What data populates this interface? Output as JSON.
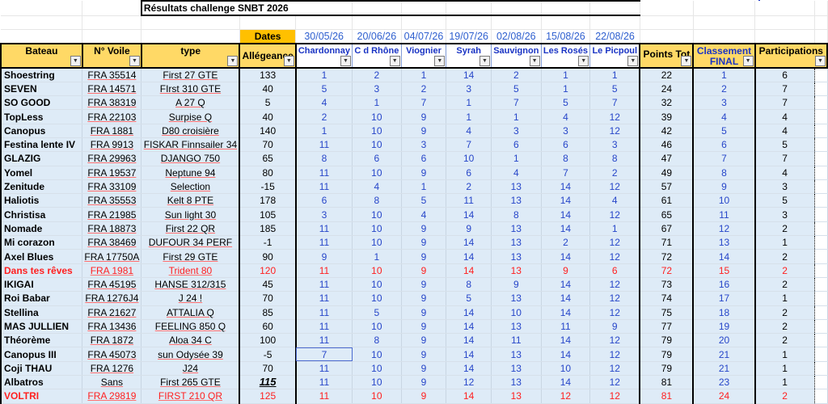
{
  "title": "Résultats challenge SNBT 2026",
  "dates_label": "Dates",
  "dates": [
    "30/05/26",
    "20/06/26",
    "04/07/26",
    "19/07/26",
    "02/08/26",
    "15/08/26",
    "22/08/26"
  ],
  "headers": {
    "bateau": "Bateau",
    "voile": "N° Voile",
    "type": "type",
    "allegeance": "Allégeance",
    "races": [
      "Chardonnay",
      "C d Rhône",
      "Viognier",
      "Syrah",
      "Sauvignon",
      "Les Rosés",
      "Le Picpoul"
    ],
    "points": "Points Tot",
    "classement_1": "Classement",
    "classement_2": "FINAL",
    "participations": "Participations"
  },
  "rows": [
    {
      "boat": "Shoestring",
      "sail": "FRA 35514",
      "type": "First 27 GTE",
      "alleg": "133",
      "r": [
        "1",
        "2",
        "1",
        "14",
        "2",
        "1",
        "1"
      ],
      "pts": "22",
      "rank": "1",
      "part": "6"
    },
    {
      "boat": "SEVEN",
      "sail": "FRA 14571",
      "type": "FIrst 310 GTE",
      "alleg": "40",
      "r": [
        "5",
        "3",
        "2",
        "3",
        "5",
        "1",
        "5"
      ],
      "pts": "24",
      "rank": "2",
      "part": "7"
    },
    {
      "boat": "SO GOOD",
      "sail": "FRA 38319",
      "type": "A 27 Q",
      "alleg": "5",
      "r": [
        "4",
        "1",
        "7",
        "1",
        "7",
        "5",
        "7"
      ],
      "pts": "32",
      "rank": "3",
      "part": "7"
    },
    {
      "boat": "TopLess",
      "sail": "FRA 22103",
      "type": "Surpise Q",
      "alleg": "40",
      "r": [
        "2",
        "10",
        "9",
        "1",
        "1",
        "4",
        "12"
      ],
      "pts": "39",
      "rank": "4",
      "part": "4"
    },
    {
      "boat": "Canopus",
      "sail": "FRA 1881",
      "type": "D80 croisière",
      "alleg": "140",
      "r": [
        "1",
        "10",
        "9",
        "4",
        "3",
        "3",
        "12"
      ],
      "pts": "42",
      "rank": "5",
      "part": "4"
    },
    {
      "boat": "Festina lente IV",
      "sail": "FRA 9913",
      "type": "FISKAR Finnsailer 34",
      "alleg": "70",
      "r": [
        "11",
        "10",
        "3",
        "7",
        "6",
        "6",
        "3"
      ],
      "pts": "46",
      "rank": "6",
      "part": "5"
    },
    {
      "boat": "GLAZIG",
      "sail": "FRA 29963",
      "type": "DJANGO 750",
      "alleg": "65",
      "r": [
        "8",
        "6",
        "6",
        "10",
        "1",
        "8",
        "8"
      ],
      "pts": "47",
      "rank": "7",
      "part": "7"
    },
    {
      "boat": "Yomel",
      "sail": "FRA 19537",
      "type": "Neptune 94",
      "alleg": "80",
      "r": [
        "11",
        "10",
        "9",
        "6",
        "4",
        "7",
        "2"
      ],
      "pts": "49",
      "rank": "8",
      "part": "4"
    },
    {
      "boat": "Zenitude",
      "sail": "FRA 33109",
      "type": "Selection",
      "alleg": "-15",
      "r": [
        "11",
        "4",
        "1",
        "2",
        "13",
        "14",
        "12"
      ],
      "pts": "57",
      "rank": "9",
      "part": "3"
    },
    {
      "boat": "Haliotis",
      "sail": "FRA 35553",
      "type": "Kelt 8 PTE",
      "alleg": "178",
      "r": [
        "6",
        "8",
        "5",
        "11",
        "13",
        "14",
        "4"
      ],
      "pts": "61",
      "rank": "10",
      "part": "5"
    },
    {
      "boat": "Christisa",
      "sail": "FRA 21985",
      "type": "Sun light 30",
      "alleg": "105",
      "r": [
        "3",
        "10",
        "4",
        "14",
        "8",
        "14",
        "12"
      ],
      "pts": "65",
      "rank": "11",
      "part": "3"
    },
    {
      "boat": "Nomade",
      "sail": "FRA 18873",
      "type": "First 22 QR",
      "alleg": "185",
      "r": [
        "11",
        "10",
        "9",
        "9",
        "13",
        "14",
        "1"
      ],
      "pts": "67",
      "rank": "12",
      "part": "2"
    },
    {
      "boat": "Mi corazon",
      "sail": "FRA 38469",
      "type": "DUFOUR 34 PERF",
      "alleg": "-1",
      "r": [
        "11",
        "10",
        "9",
        "14",
        "13",
        "2",
        "12"
      ],
      "pts": "71",
      "rank": "13",
      "part": "1"
    },
    {
      "boat": "Axel Blues",
      "sail": "FRA 17750A",
      "type": "First 29 GTE",
      "alleg": "90",
      "r": [
        "9",
        "1",
        "9",
        "14",
        "13",
        "14",
        "12"
      ],
      "pts": "72",
      "rank": "14",
      "part": "2"
    },
    {
      "boat": "Dans tes rêves",
      "sail": "FRA 1981",
      "type": "Trident 80",
      "alleg": "120",
      "r": [
        "11",
        "10",
        "9",
        "14",
        "13",
        "9",
        "6"
      ],
      "pts": "72",
      "rank": "15",
      "part": "2",
      "red": true
    },
    {
      "boat": "IKIGAI",
      "sail": "FRA 45195",
      "type": "HANSE 312/315",
      "alleg": "45",
      "r": [
        "11",
        "10",
        "9",
        "8",
        "9",
        "14",
        "12"
      ],
      "pts": "73",
      "rank": "16",
      "part": "2"
    },
    {
      "boat": "Roi Babar",
      "sail": "FRA 1276J4",
      "type": "J 24 !",
      "alleg": "70",
      "r": [
        "11",
        "10",
        "9",
        "5",
        "13",
        "14",
        "12"
      ],
      "pts": "74",
      "rank": "17",
      "part": "1"
    },
    {
      "boat": "Stellina",
      "sail": "FRA 21627",
      "type": "ATTALIA Q",
      "alleg": "85",
      "r": [
        "11",
        "5",
        "9",
        "14",
        "10",
        "14",
        "12"
      ],
      "pts": "75",
      "rank": "18",
      "part": "2"
    },
    {
      "boat": "MAS JULLIEN",
      "sail": "FRA 13436",
      "type": "FEELING 850 Q",
      "alleg": "60",
      "r": [
        "11",
        "10",
        "9",
        "14",
        "13",
        "11",
        "9"
      ],
      "pts": "77",
      "rank": "19",
      "part": "2"
    },
    {
      "boat": "Théorème",
      "sail": "FRA 1872",
      "type": "Aloa 34 C",
      "alleg": "100",
      "r": [
        "11",
        "8",
        "9",
        "14",
        "11",
        "14",
        "12"
      ],
      "pts": "79",
      "rank": "20",
      "part": "2"
    },
    {
      "boat": "Canopus III",
      "sail": "FRA 45073",
      "type": "sun Odysée 39",
      "alleg": "-5",
      "r": [
        "7",
        "10",
        "9",
        "14",
        "13",
        "14",
        "12"
      ],
      "pts": "79",
      "rank": "21",
      "part": "1"
    },
    {
      "boat": "Coji THAU",
      "sail": "FRA 1276",
      "type": "J24",
      "alleg": "70",
      "r": [
        "11",
        "10",
        "9",
        "14",
        "13",
        "10",
        "12"
      ],
      "pts": "79",
      "rank": "21",
      "part": "1"
    },
    {
      "boat": "Albatros",
      "sail": "Sans",
      "type": "First 265 GTE",
      "alleg": "115",
      "r": [
        "11",
        "10",
        "9",
        "12",
        "13",
        "14",
        "12"
      ],
      "pts": "81",
      "rank": "23",
      "part": "1"
    },
    {
      "boat": "VOLTRI",
      "sail": "FRA 29819",
      "type": "FIRST 210 QR",
      "alleg": "125",
      "r": [
        "11",
        "10",
        "9",
        "14",
        "13",
        "12",
        "12"
      ],
      "pts": "81",
      "rank": "24",
      "part": "2",
      "red": true
    }
  ]
}
